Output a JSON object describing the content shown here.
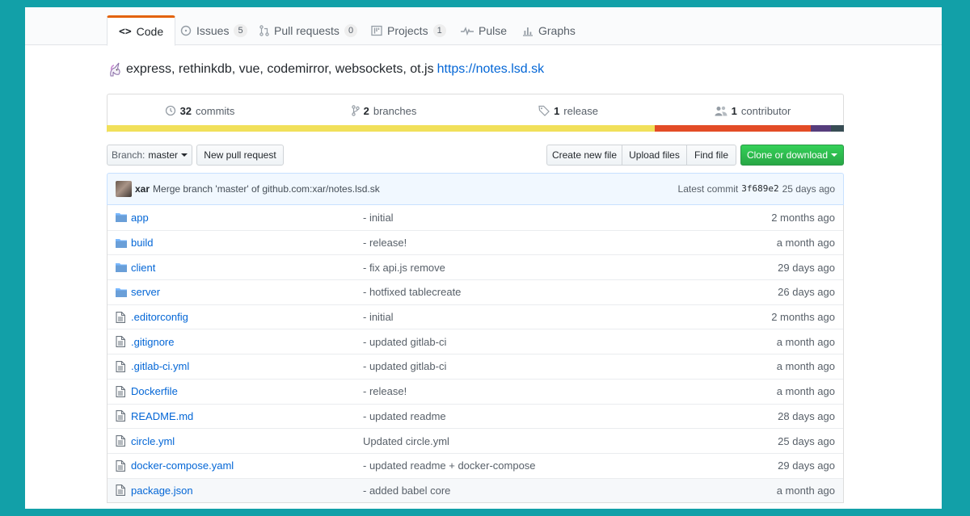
{
  "tabs": [
    {
      "label": "Code",
      "icon": "code-icon",
      "selected": true
    },
    {
      "label": "Issues",
      "icon": "issue-icon",
      "count": "5"
    },
    {
      "label": "Pull requests",
      "icon": "pull-request-icon",
      "count": "0"
    },
    {
      "label": "Projects",
      "icon": "project-icon",
      "count": "1"
    },
    {
      "label": "Pulse",
      "icon": "pulse-icon"
    },
    {
      "label": "Graphs",
      "icon": "graph-icon"
    }
  ],
  "description": {
    "text": "express, rethinkdb, vue, codemirror, websockets, ot.js",
    "link": "https://notes.lsd.sk",
    "icon": "unicorn-emoji-icon"
  },
  "summary": {
    "commits": {
      "num": "32",
      "label": "commits"
    },
    "branches": {
      "num": "2",
      "label": "branches"
    },
    "releases": {
      "num": "1",
      "label": "release"
    },
    "contributors": {
      "num": "1",
      "label": "contributor"
    }
  },
  "language_bar": [
    {
      "color": "#f1e05a",
      "percent": 74.3
    },
    {
      "color": "#e34c26",
      "percent": 21.2
    },
    {
      "color": "#563d7c",
      "percent": 2.8
    },
    {
      "color": "#384d54",
      "percent": 1.7
    }
  ],
  "toolbar": {
    "branch_prefix": "Branch:",
    "branch_name": "master",
    "new_pr": "New pull request",
    "create_file": "Create new file",
    "upload_files": "Upload files",
    "find_file": "Find file",
    "clone": "Clone or download"
  },
  "latest_commit": {
    "author": "xar",
    "message": "Merge branch 'master' of github.com:xar/notes.lsd.sk",
    "label": "Latest commit",
    "sha": "3f689e2",
    "age": "25 days ago"
  },
  "files": [
    {
      "name": "app",
      "type": "dir",
      "message": "- initial",
      "age": "2 months ago"
    },
    {
      "name": "build",
      "type": "dir",
      "message": "- release!",
      "age": "a month ago"
    },
    {
      "name": "client",
      "type": "dir",
      "message": "- fix api.js remove",
      "age": "29 days ago"
    },
    {
      "name": "server",
      "type": "dir",
      "message": "- hotfixed tablecreate",
      "age": "26 days ago"
    },
    {
      "name": ".editorconfig",
      "type": "file",
      "message": "- initial",
      "age": "2 months ago"
    },
    {
      "name": ".gitignore",
      "type": "file",
      "message": "- updated gitlab-ci",
      "age": "a month ago"
    },
    {
      "name": ".gitlab-ci.yml",
      "type": "file",
      "message": "- updated gitlab-ci",
      "age": "a month ago"
    },
    {
      "name": "Dockerfile",
      "type": "file",
      "message": "- release!",
      "age": "a month ago"
    },
    {
      "name": "README.md",
      "type": "file",
      "message": "- updated readme",
      "age": "28 days ago"
    },
    {
      "name": "circle.yml",
      "type": "file",
      "message": "Updated circle.yml",
      "age": "25 days ago"
    },
    {
      "name": "docker-compose.yaml",
      "type": "file",
      "message": "- updated readme + docker-compose",
      "age": "29 days ago"
    },
    {
      "name": "package.json",
      "type": "file",
      "message": "- added babel core",
      "age": "a month ago"
    }
  ]
}
